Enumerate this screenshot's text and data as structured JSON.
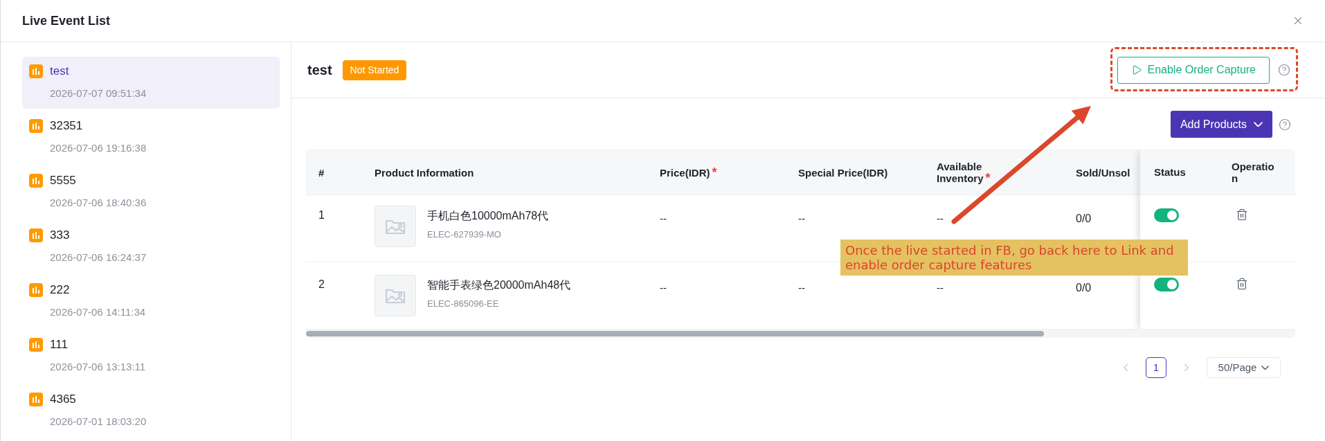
{
  "window": {
    "title": "Live Event List"
  },
  "events": [
    {
      "name": "test",
      "time": "2026-07-07 09:51:34",
      "selected": true
    },
    {
      "name": "32351",
      "time": "2026-07-06 19:16:38",
      "selected": false
    },
    {
      "name": "5555",
      "time": "2026-07-06 18:40:36",
      "selected": false
    },
    {
      "name": "333",
      "time": "2026-07-06 16:24:37",
      "selected": false
    },
    {
      "name": "222",
      "time": "2026-07-06 14:11:34",
      "selected": false
    },
    {
      "name": "111",
      "time": "2026-07-06 13:13:11",
      "selected": false
    },
    {
      "name": "4365",
      "time": "2026-07-01 18:03:20",
      "selected": false
    }
  ],
  "event": {
    "title": "test",
    "status": "Not Started",
    "capture_button": "Enable Order Capture",
    "add_button": "Add Products"
  },
  "table": {
    "columns": [
      {
        "label": "#"
      },
      {
        "label": "Product Information"
      },
      {
        "label": "Price(IDR)",
        "mark": "*"
      },
      {
        "label": "Special Price(IDR)"
      },
      {
        "label": "Available Inventory",
        "mark": "*"
      },
      {
        "label": "Sold/Unsol"
      },
      {
        "label": "Status"
      },
      {
        "label": "Operation"
      }
    ],
    "rows": [
      {
        "index": "1",
        "name": "手机白色10000mAh78代",
        "sku": "ELEC-627939-MO",
        "price": "--",
        "special_price": "--",
        "inventory": "--",
        "sold": "0/0",
        "on": true
      },
      {
        "index": "2",
        "name": "智能手表绿色20000mAh48代",
        "sku": "ELEC-865096-EE",
        "price": "--",
        "special_price": "--",
        "inventory": "--",
        "sold": "0/0",
        "on": true
      }
    ]
  },
  "pagination": {
    "prev_disabled": true,
    "pages": [
      {
        "label": "1",
        "selected": true
      }
    ],
    "next_disabled": true,
    "page_size": "50/Page"
  },
  "annotation": {
    "note": "Once the live started in FB, go back here to Link and enable order capture features"
  }
}
